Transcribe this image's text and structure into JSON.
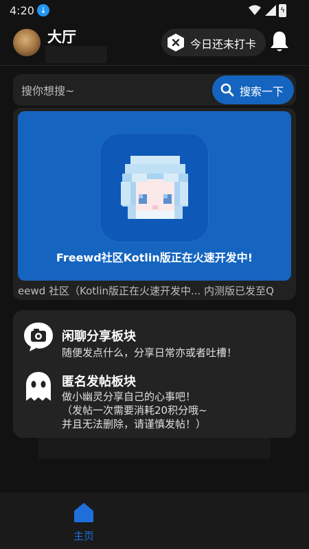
{
  "status_bar": {
    "time": "4:20",
    "download_icon": "download-icon",
    "wifi_icon": "wifi-icon",
    "signal_icon": "signal-icon",
    "battery_icon": "battery-charging-icon"
  },
  "header": {
    "title": "大厅",
    "checkin_label": "今日还未打卡",
    "checkin_icon": "close-hexagon-icon",
    "bell_icon": "bell-icon"
  },
  "search": {
    "placeholder": "搜你想搜~",
    "button_label": "搜索一下",
    "button_icon": "search-icon"
  },
  "banner": {
    "text": "Freewd社区Kotlin版正在火速开发中!",
    "marquee": "eewd 社区（Kotlin版正在火速开发中... 内测版已发至Q"
  },
  "boards": [
    {
      "title": "闲聊分享板块",
      "desc": "随便发点什么，分享日常亦或者吐槽！",
      "icon": "chat-camera-icon"
    },
    {
      "title": "匿名发帖板块",
      "desc": "做小幽灵分享自己的心事吧！\n（发帖一次需要消耗20积分哦~\n并且无法删除，请谨慎发帖！）",
      "icon": "ghost-icon"
    }
  ],
  "bottom_nav": {
    "home_label": "主页",
    "home_icon": "home-icon"
  },
  "colors": {
    "accent": "#1565c0",
    "nav_active": "#1e6fd9",
    "background": "#121212",
    "card": "#232323"
  }
}
